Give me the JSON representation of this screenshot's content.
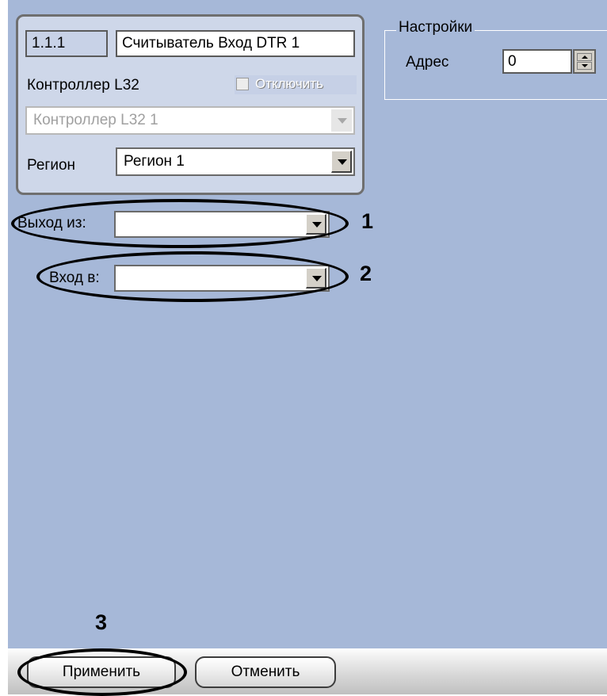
{
  "reader": {
    "number": "1.1.1",
    "name": "Считыватель Вход DTR 1"
  },
  "controller": {
    "label": "Контроллер L32",
    "disable_label": "Отключить",
    "selected": "Контроллер L32 1"
  },
  "region": {
    "label": "Регион",
    "selected": "Регион 1"
  },
  "exit_from": {
    "label": "Выход из:",
    "selected": ""
  },
  "entry_to": {
    "label": "Вход в:",
    "selected": ""
  },
  "settings": {
    "title": "Настройки",
    "address_label": "Адрес",
    "address_value": "0"
  },
  "callouts": [
    "1",
    "2",
    "3"
  ],
  "buttons": {
    "apply": "Применить",
    "cancel": "Отменить"
  },
  "colors": {
    "panel_bg": "#a6b8d8",
    "group_bg": "#ced7e9"
  }
}
